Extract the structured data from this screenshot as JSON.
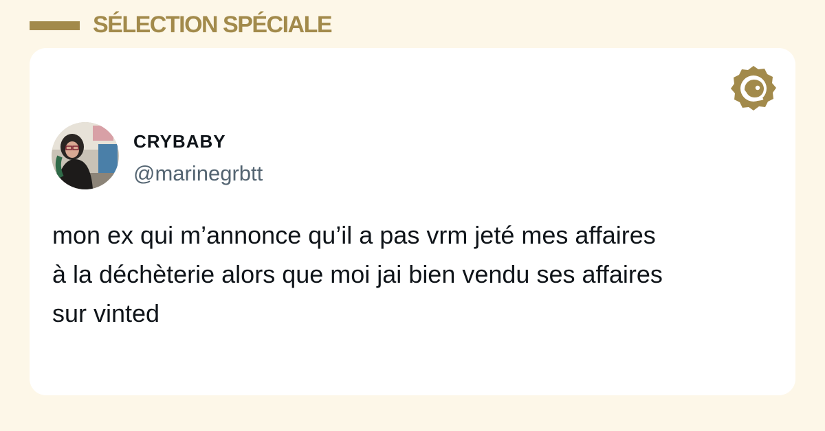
{
  "header": {
    "title": "SÉLECTION SPÉCIALE"
  },
  "colors": {
    "background": "#fdf7e8",
    "accent_gold": "#a28a4b",
    "card": "#ffffff",
    "text_primary": "#0f1419",
    "text_secondary": "#536471"
  },
  "brand": {
    "icon": "gold-seal-logo-icon"
  },
  "tweet": {
    "author": {
      "display_name": "CRYBABY",
      "handle": "@marinegrbtt",
      "avatar_icon": "profile-photo-avatar"
    },
    "text_lines": [
      "mon ex qui m’annonce qu’il a pas vrm jeté mes affaires",
      "à la déchèterie alors que moi jai bien vendu ses affaires",
      "sur vinted"
    ]
  }
}
